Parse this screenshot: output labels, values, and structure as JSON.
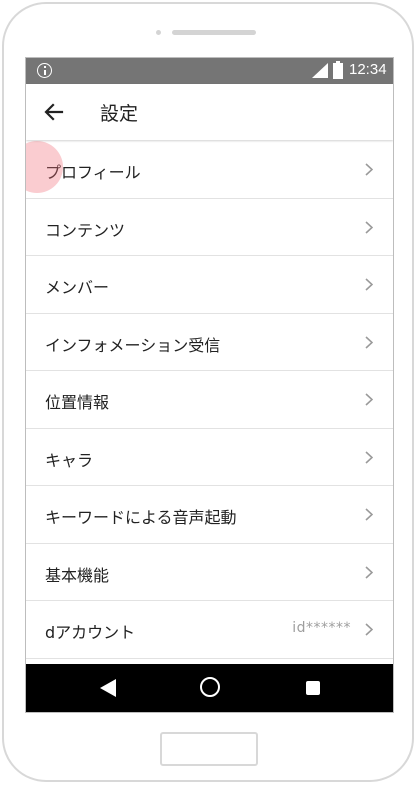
{
  "status_bar": {
    "time": "12:34"
  },
  "app_bar": {
    "title": "設定"
  },
  "settings_items": [
    {
      "label": "プロフィール"
    },
    {
      "label": "コンテンツ"
    },
    {
      "label": "メンバー"
    },
    {
      "label": "インフォメーション受信"
    },
    {
      "label": "位置情報"
    },
    {
      "label": "キャラ"
    },
    {
      "label": "キーワードによる音声起動"
    },
    {
      "label": "基本機能"
    },
    {
      "label": "dアカウント",
      "value": "id******"
    }
  ],
  "icons": {
    "status": [
      "info-icon",
      "signal-icon",
      "battery-icon"
    ],
    "app_bar": "back-arrow-icon",
    "row": "chevron-right-icon",
    "nav": [
      "nav-back-icon",
      "nav-home-icon",
      "nav-recents-icon"
    ]
  },
  "colors": {
    "status_bar": "#757575",
    "nav_bar": "#000000",
    "touch_highlight": "#f06e78"
  }
}
